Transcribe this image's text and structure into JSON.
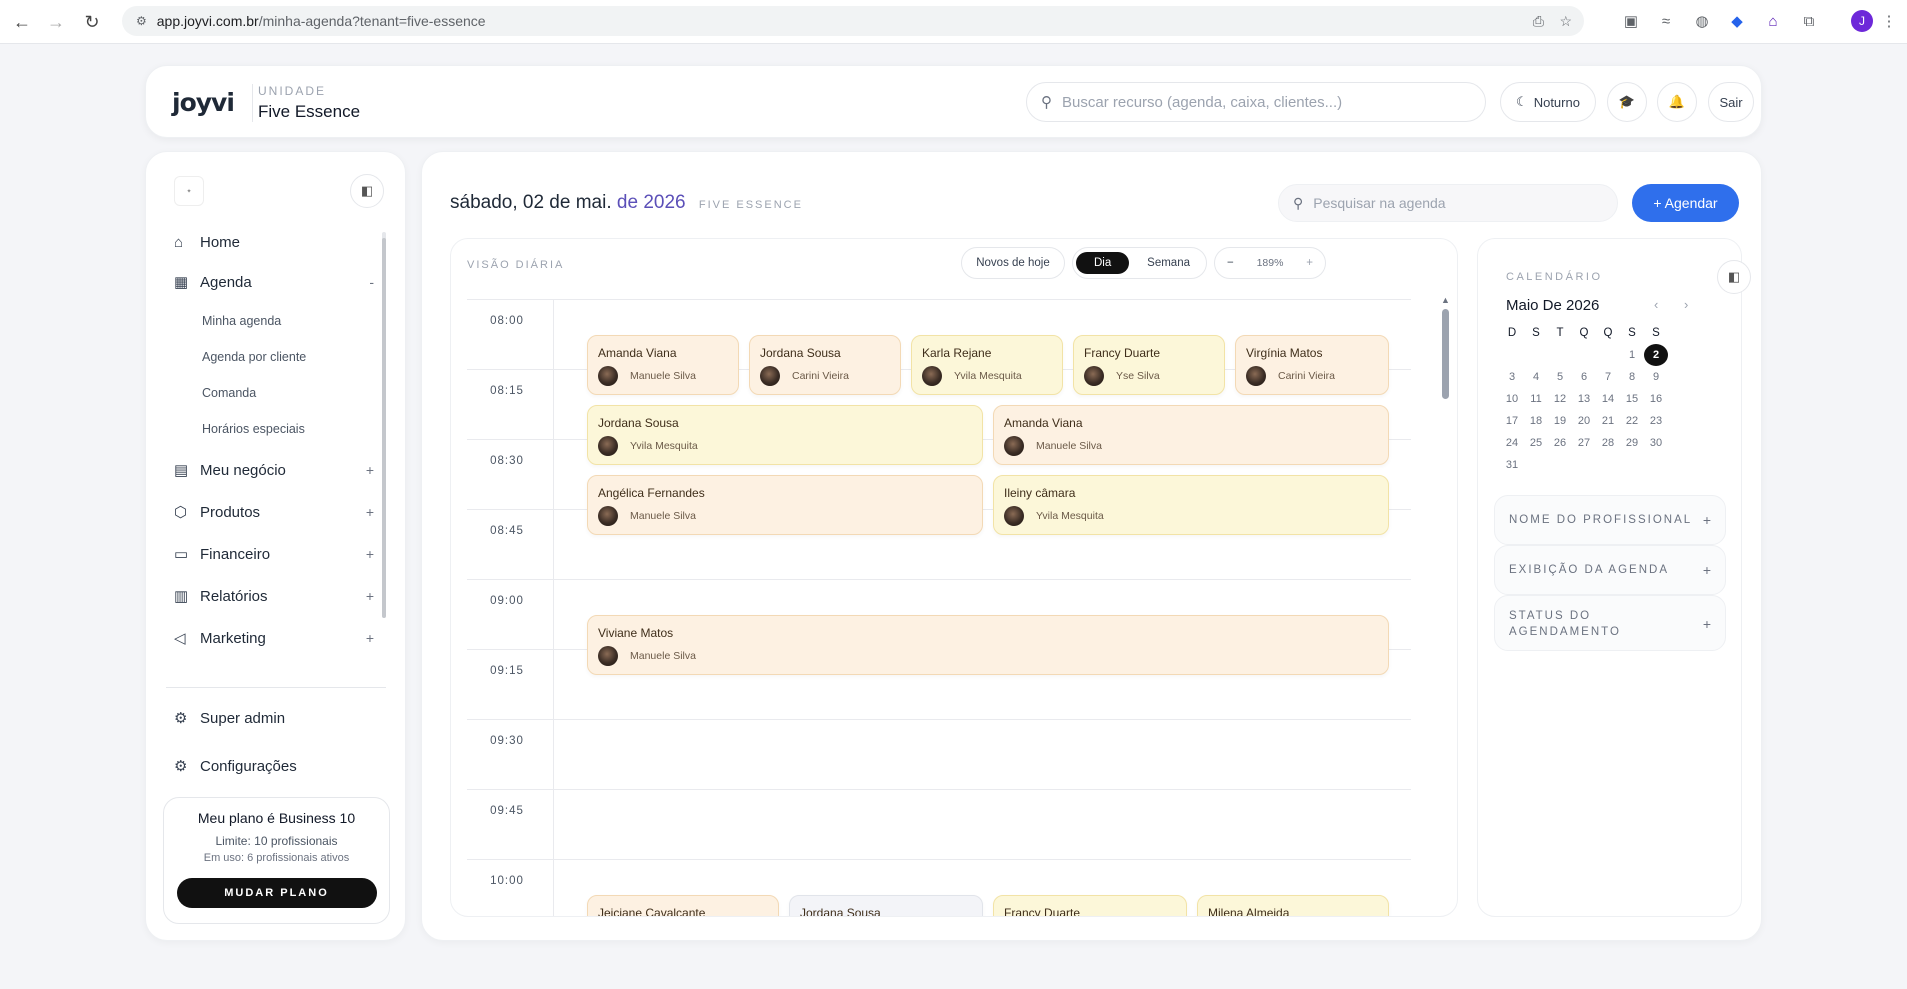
{
  "browser": {
    "url_host": "app.joyvi.com.br",
    "url_path": "/minha-agenda?tenant=five-essence"
  },
  "topbar": {
    "logo": "joyvi",
    "unit_label": "UNIDADE",
    "unit_name": "Five Essence",
    "search_placeholder": "Buscar recurso (agenda, caixa, clientes...)",
    "theme_label": "Noturno",
    "logout_label": "Sair"
  },
  "sidebar": {
    "items": [
      {
        "label": "Home",
        "icon": "home-icon"
      },
      {
        "label": "Agenda",
        "icon": "calendar-icon",
        "toggle": "-"
      },
      {
        "label": "Meu negócio",
        "icon": "store-icon",
        "toggle": "+"
      },
      {
        "label": "Produtos",
        "icon": "package-icon",
        "toggle": "+"
      },
      {
        "label": "Financeiro",
        "icon": "card-icon",
        "toggle": "+"
      },
      {
        "label": "Relatórios",
        "icon": "chart-icon",
        "toggle": "+"
      },
      {
        "label": "Marketing",
        "icon": "megaphone-icon",
        "toggle": "+"
      }
    ],
    "subitems": [
      "Minha agenda",
      "Agenda por cliente",
      "Comanda",
      "Horários especiais"
    ],
    "super_admin": "Super admin",
    "settings": "Configurações",
    "plan": {
      "title": "Meu plano é Business 10",
      "limit": "Limite: 10 profissionais",
      "usage": "Em uso: 6 profissionais ativos",
      "button": "MUDAR PLANO"
    }
  },
  "main": {
    "date_prefix": "sábado, 02 de mai.",
    "date_year": "de 2026",
    "unit": "FIVE ESSENCE",
    "search_placeholder": "Pesquisar na agenda",
    "schedule_button": "+ Agendar",
    "view_label": "VISÃO DIÁRIA",
    "new_today": "Novos de hoje",
    "day": "Dia",
    "week": "Semana",
    "zoom": "189%",
    "times": [
      "08:00",
      "08:15",
      "08:30",
      "08:45",
      "09:00",
      "09:15",
      "09:30",
      "09:45",
      "10:00"
    ],
    "appointments": [
      {
        "client": "Amanda Viana",
        "pro": "Manuele Silva"
      },
      {
        "client": "Jordana Sousa",
        "pro": "Carini Vieira"
      },
      {
        "client": "Karla Rejane",
        "pro": "Yvila Mesquita"
      },
      {
        "client": "Francy Duarte",
        "pro": "Yse Silva"
      },
      {
        "client": "Virgínia Matos",
        "pro": "Carini Vieira"
      },
      {
        "client": "Jordana Sousa",
        "pro": "Yvila Mesquita"
      },
      {
        "client": "Amanda Viana",
        "pro": "Manuele Silva"
      },
      {
        "client": "Angélica Fernandes",
        "pro": "Manuele Silva"
      },
      {
        "client": "Ileiny câmara",
        "pro": "Yvila Mesquita"
      },
      {
        "client": "Viviane Matos",
        "pro": "Manuele Silva"
      },
      {
        "client": "Jeiciane Cavalcante",
        "pro": ""
      },
      {
        "client": "Jordana Sousa",
        "pro": ""
      },
      {
        "client": "Francy Duarte",
        "pro": ""
      },
      {
        "client": "Milena Almeida",
        "pro": ""
      }
    ]
  },
  "right": {
    "calendar_label": "CALENDÁRIO",
    "month": "Maio De 2026",
    "weekdays": [
      "D",
      "S",
      "T",
      "Q",
      "Q",
      "S",
      "S"
    ],
    "selected_day": "2",
    "filters": [
      "NOME DO PROFISSIONAL",
      "EXIBIÇÃO DA AGENDA",
      "STATUS DO AGENDAMENTO"
    ]
  }
}
